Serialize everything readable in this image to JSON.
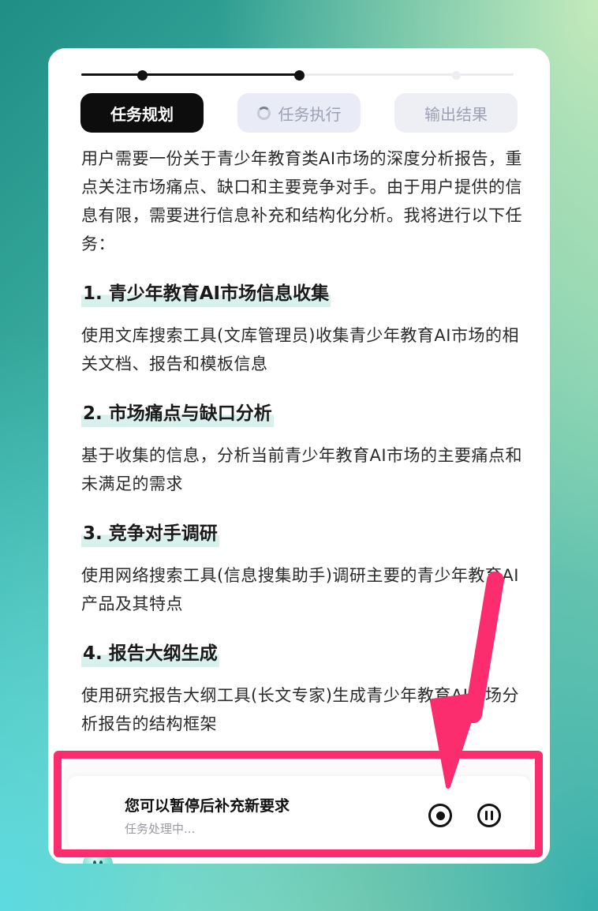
{
  "progress": {
    "steps_total": 3,
    "current_step": 2
  },
  "steps": [
    {
      "label": "任务规划",
      "state": "completed"
    },
    {
      "label": "任务执行",
      "state": "running"
    },
    {
      "label": "输出结果",
      "state": "pending"
    }
  ],
  "intro": "用户需要一份关于青少年教育类AI市场的深度分析报告，重点关注市场痛点、缺口和主要竞争对手。由于用户提供的信息有限，需要进行信息补充和结构化分析。我将进行以下任务：",
  "tasks": [
    {
      "title": "1. 青少年教育AI市场信息收集",
      "desc": "使用文库搜索工具(文库管理员)收集青少年教育AI市场的相关文档、报告和模板信息"
    },
    {
      "title": "2. 市场痛点与缺口分析",
      "desc": "基于收集的信息，分析当前青少年教育AI市场的主要痛点和未满足的需求"
    },
    {
      "title": "3. 竞争对手调研",
      "desc": "使用网络搜索工具(信息搜集助手)调研主要的青少年教育AI产品及其特点"
    },
    {
      "title": "4. 报告大纲生成",
      "desc": "使用研究报告大纲工具(长文专家)生成青少年教育AI市场分析报告的结构框架"
    }
  ],
  "status": {
    "title": "您可以暂停后补充新要求",
    "subtitle": "任务处理中...",
    "stop_icon": "stop-circle-icon",
    "pause_icon": "pause-circle-icon"
  },
  "colors": {
    "accent": "#0d0d0d",
    "highlight": "#fb2d6e",
    "task_marker": "#d9f1ec"
  }
}
